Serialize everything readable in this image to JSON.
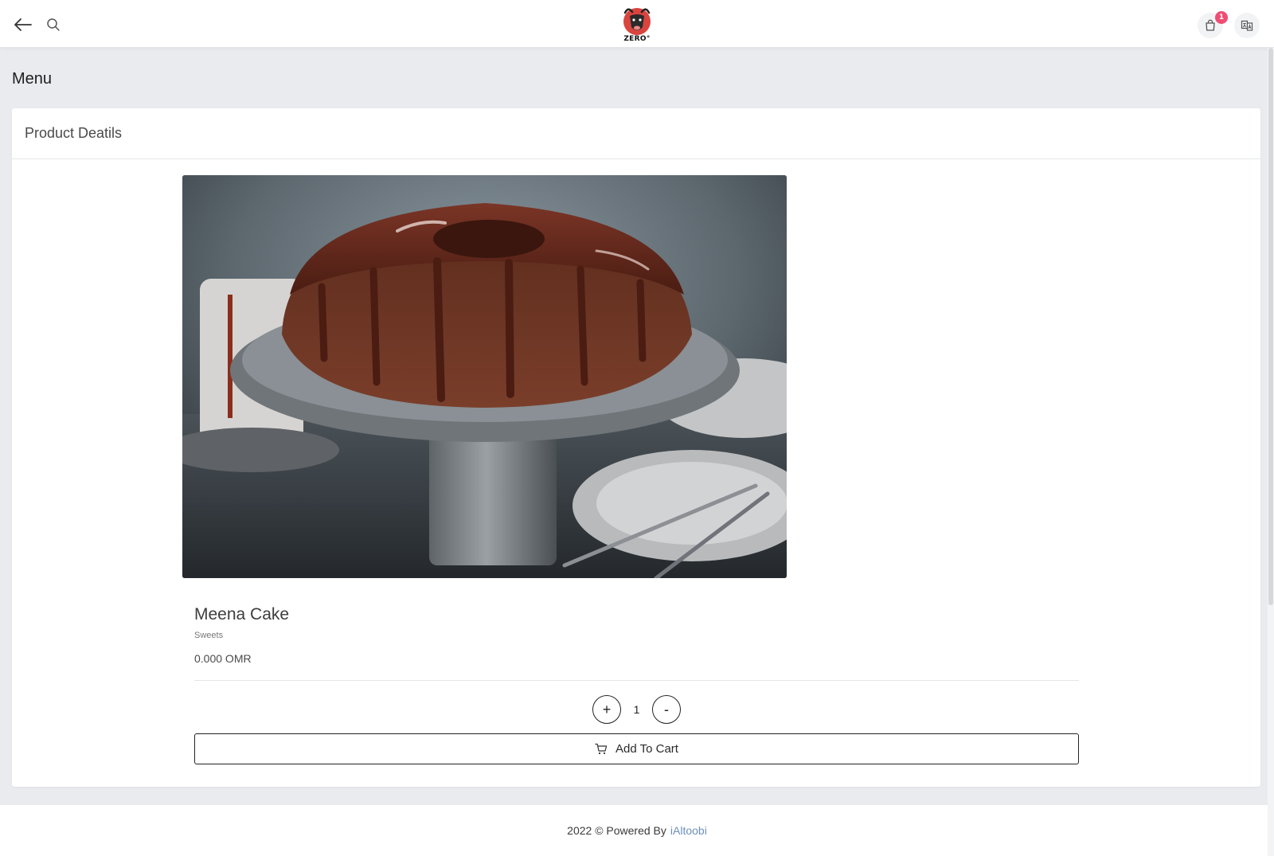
{
  "header": {
    "back_icon": "arrow-left-icon",
    "search_icon": "search-icon",
    "logo_text": "ZERO°",
    "cart_icon": "shopping-bag-icon",
    "cart_count": "1",
    "language_icon": "translate-icon"
  },
  "page": {
    "title": "Menu"
  },
  "card": {
    "title": "Product Deatils"
  },
  "product": {
    "name": "Meena Cake",
    "category": "Sweets",
    "price": "0.000 OMR",
    "quantity": "1",
    "plus_label": "+",
    "minus_label": "-",
    "add_to_cart_label": "Add To Cart"
  },
  "footer": {
    "text": "2022 © Powered By",
    "link_text": "iAltoobi"
  },
  "colors": {
    "accent_badge": "#ef4d74",
    "footer_link": "#6f8fb8",
    "page_background": "#e9ebef"
  }
}
